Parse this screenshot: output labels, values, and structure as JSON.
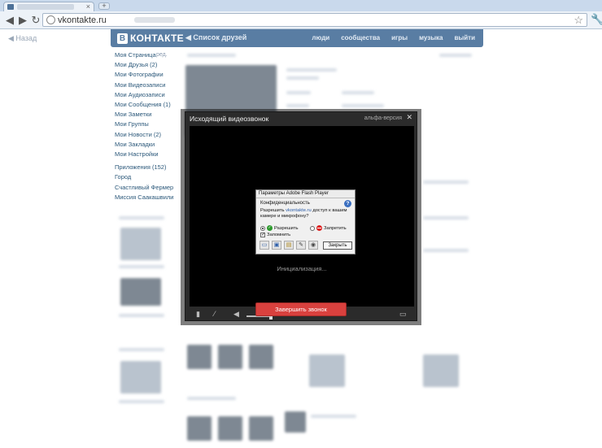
{
  "browser": {
    "new_tab_label": "+",
    "tab_close": "×",
    "url": "vkontakte.ru",
    "back_glyph": "◀",
    "forward_glyph": "▶",
    "reload_glyph": "↻",
    "star_glyph": "☆",
    "wrench_glyph": "🔧"
  },
  "vk": {
    "back_link": "◀ Назад",
    "logo_letter": "В",
    "logo_word": "КОНТАКТЕ",
    "friends_link": "◀ Список друзей",
    "topnav": [
      "люди",
      "сообщества",
      "игры",
      "музыка",
      "выйти"
    ],
    "menu_edit": "ред.",
    "menu": [
      "Моя Страница",
      "Мои Друзья (2)",
      "Мои Фотографии",
      "Мои Видеозаписи",
      "Мои Аудиозаписи",
      "Мои Сообщения (1)",
      "Мои Заметки",
      "Мои Группы",
      "Мои Новости (2)",
      "Мои Закладки",
      "Мои Настройки"
    ],
    "apps": [
      "Приложения (152)",
      "Город",
      "Счастливый Фермер",
      "Миссия Саакашвили"
    ]
  },
  "call": {
    "title": "Исходящий видеозвонок",
    "alpha": "альфа-версия",
    "close": "✕",
    "init_text": "Инициализация...",
    "end_call": "Завершить звонок"
  },
  "flash": {
    "title": "Параметры Adobe Flash Player",
    "heading": "Конфиденциальность",
    "help": "?",
    "question_before": "Разрешить ",
    "question_host": "vkontakte.ru",
    "question_after": " доступ к вашим камере и микрофону?",
    "allow": "Разрешить",
    "deny": "Запретить",
    "remember": "Запомнить",
    "close": "Закрыть"
  }
}
